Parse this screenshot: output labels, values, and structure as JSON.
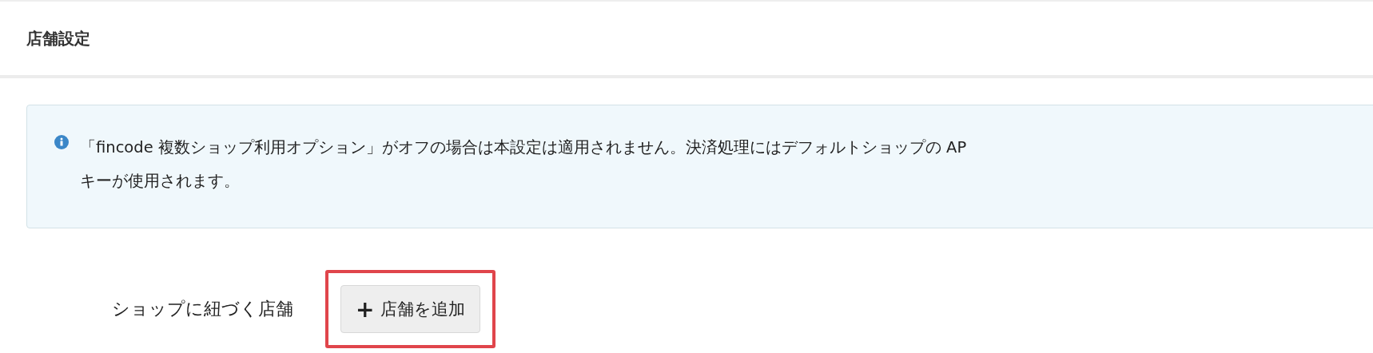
{
  "header": {
    "title": "店舗設定"
  },
  "notice": {
    "lines": [
      "「fincode 複数ショップ利用オプション」がオフの場合は本設定は適用されません。決済処理にはデフォルトショップの AP",
      "キーが使用されます。"
    ]
  },
  "shop_stores": {
    "label": "ショップに紐づく店舗",
    "add_button": {
      "icon": "+",
      "label": "店舗を追加",
      "highlighted": true
    }
  }
}
